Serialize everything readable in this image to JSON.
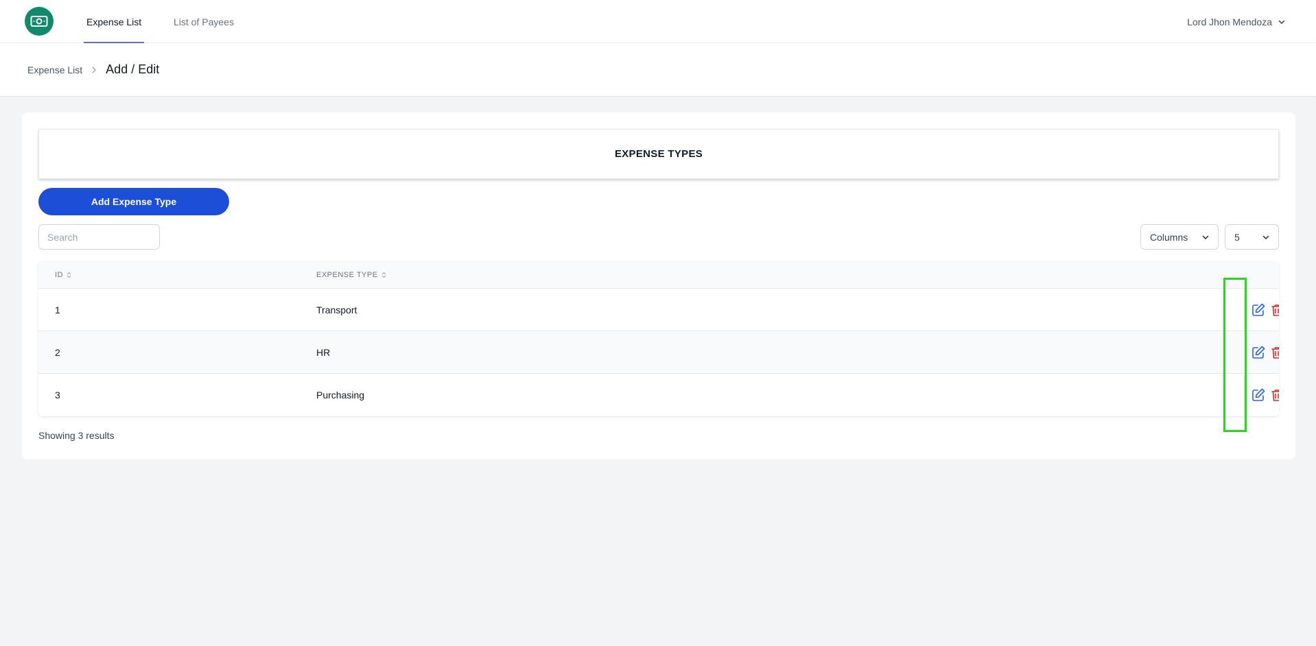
{
  "topnav": {
    "logo_icon": "money-bill-icon",
    "tabs": [
      {
        "label": "Expense List",
        "active": true
      },
      {
        "label": "List of Payees",
        "active": false
      }
    ],
    "user_name": "Lord Jhon Mendoza"
  },
  "breadcrumb": {
    "parent": "Expense List",
    "current": "Add / Edit"
  },
  "section": {
    "title": "EXPENSE TYPES",
    "add_button": "Add Expense Type"
  },
  "controls": {
    "search_placeholder": "Search",
    "columns_label": "Columns",
    "page_size": "5"
  },
  "table": {
    "columns": [
      "ID",
      "EXPENSE TYPE"
    ],
    "rows": [
      {
        "id": "1",
        "expense_type": "Transport"
      },
      {
        "id": "2",
        "expense_type": "HR"
      },
      {
        "id": "3",
        "expense_type": "Purchasing"
      }
    ]
  },
  "footer": {
    "results_text": "Showing 3 results"
  },
  "colors": {
    "primary_button": "#1d4ed8",
    "logo_green": "#0f8b6c",
    "edit_icon": "#2563eb",
    "delete_icon": "#dc2626",
    "highlight": "#22dd11"
  }
}
